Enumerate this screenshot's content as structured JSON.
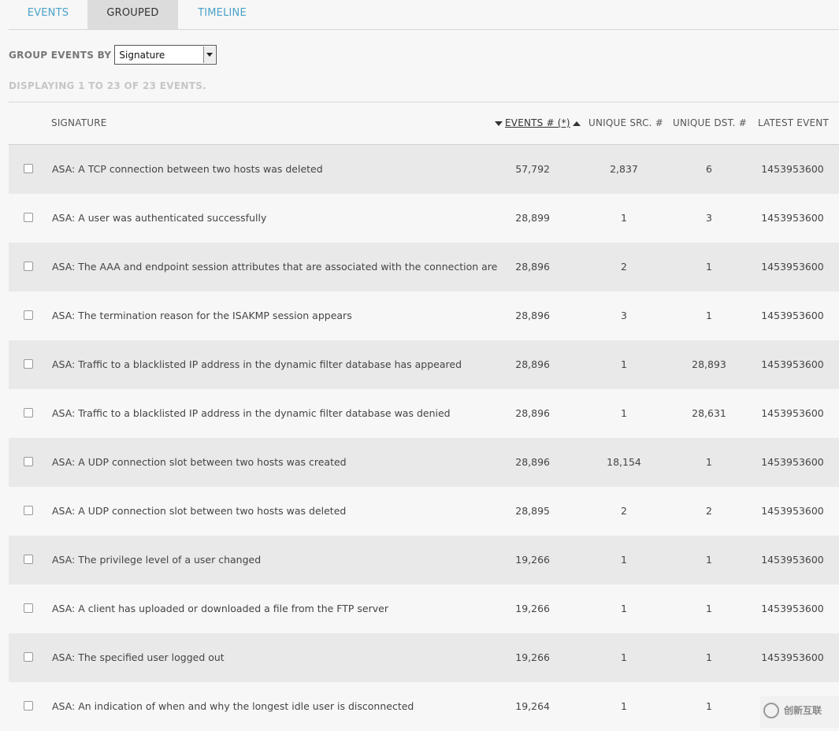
{
  "tabs": [
    {
      "label": "EVENTS"
    },
    {
      "label": "GROUPED"
    },
    {
      "label": "TIMELINE"
    }
  ],
  "group_by": {
    "label": "GROUP EVENTS BY",
    "selected": "Signature"
  },
  "displaying": "DISPLAYING 1 TO 23 OF 23 EVENTS.",
  "columns": {
    "signature": "SIGNATURE",
    "events": "EVENTS # (*)",
    "unique_src": "UNIQUE SRC. #",
    "unique_dst": "UNIQUE DST. #",
    "latest": "LATEST EVENT"
  },
  "rows": [
    {
      "signature": "ASA: A TCP connection between two hosts was deleted",
      "events": "57,792",
      "src": "2,837",
      "dst": "6",
      "latest": "1453953600"
    },
    {
      "signature": "ASA: A user was authenticated successfully",
      "events": "28,899",
      "src": "1",
      "dst": "3",
      "latest": "1453953600"
    },
    {
      "signature": "ASA: The AAA and endpoint session attributes that are associated with the connection are",
      "events": "28,896",
      "src": "2",
      "dst": "1",
      "latest": "1453953600"
    },
    {
      "signature": "ASA: The termination reason for the ISAKMP session appears",
      "events": "28,896",
      "src": "3",
      "dst": "1",
      "latest": "1453953600"
    },
    {
      "signature": "ASA: Traffic to a blacklisted IP address in the dynamic filter database has appeared",
      "events": "28,896",
      "src": "1",
      "dst": "28,893",
      "latest": "1453953600"
    },
    {
      "signature": "ASA: Traffic to a blacklisted IP address in the dynamic filter database was denied",
      "events": "28,896",
      "src": "1",
      "dst": "28,631",
      "latest": "1453953600"
    },
    {
      "signature": "ASA: A UDP connection slot between two hosts was created",
      "events": "28,896",
      "src": "18,154",
      "dst": "1",
      "latest": "1453953600"
    },
    {
      "signature": "ASA: A UDP connection slot between two hosts was deleted",
      "events": "28,895",
      "src": "2",
      "dst": "2",
      "latest": "1453953600"
    },
    {
      "signature": "ASA: The privilege level of a user changed",
      "events": "19,266",
      "src": "1",
      "dst": "1",
      "latest": "1453953600"
    },
    {
      "signature": "ASA: A client has uploaded or downloaded a file from the FTP server",
      "events": "19,266",
      "src": "1",
      "dst": "1",
      "latest": "1453953600"
    },
    {
      "signature": "ASA: The specified user logged out",
      "events": "19,266",
      "src": "1",
      "dst": "1",
      "latest": "1453953600"
    },
    {
      "signature": "ASA: An indication of when and why the longest idle user is disconnected",
      "events": "19,264",
      "src": "1",
      "dst": "1",
      "latest": ""
    }
  ],
  "watermark": {
    "text": "创新互联",
    "icon": "logo-icon"
  }
}
